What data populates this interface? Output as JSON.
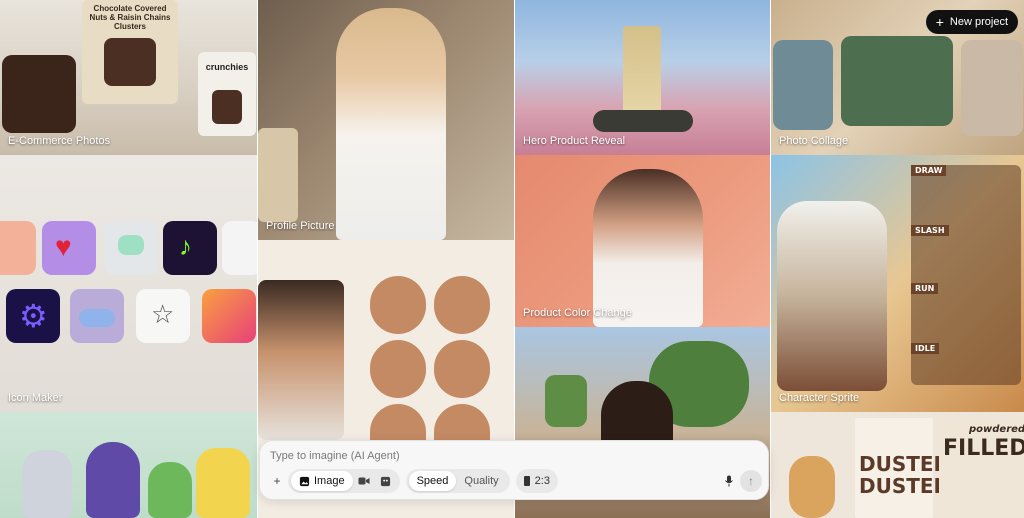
{
  "header": {
    "new_project_label": "New project"
  },
  "tiles": {
    "ecommerce": {
      "label": "E-Commerce Photos",
      "pack_text": "Chocolate Covered Nuts & Raisin Chains Clusters",
      "bag_text": "crunchies"
    },
    "profile": {
      "label": "Profile Picture"
    },
    "hero": {
      "label": "Hero Product Reveal"
    },
    "collage": {
      "label": "Photo Collage"
    },
    "icon_maker": {
      "label": "Icon Maker"
    },
    "color_change": {
      "label": "Product Color Change"
    },
    "sprite": {
      "label": "Character Sprite",
      "rows": [
        "DRAW",
        "SLASH",
        "RUN",
        "IDLE"
      ]
    },
    "donut": {
      "poster_top": "powdered",
      "poster_left": "DUSTED",
      "poster_left2": "DUSTED",
      "poster_right": "FILLED"
    }
  },
  "prompt": {
    "placeholder": "Type to imagine (AI Agent)",
    "mode_image_label": "Image",
    "speed_label": "Speed",
    "quality_label": "Quality",
    "aspect_label": "2:3"
  },
  "icons": [
    "plus-icon",
    "image-icon",
    "video-icon",
    "chat-icon",
    "mic-icon",
    "arrow-up-icon"
  ],
  "colors": {
    "button_dark": "#111111",
    "prompt_bg": "#f7f7f7"
  }
}
